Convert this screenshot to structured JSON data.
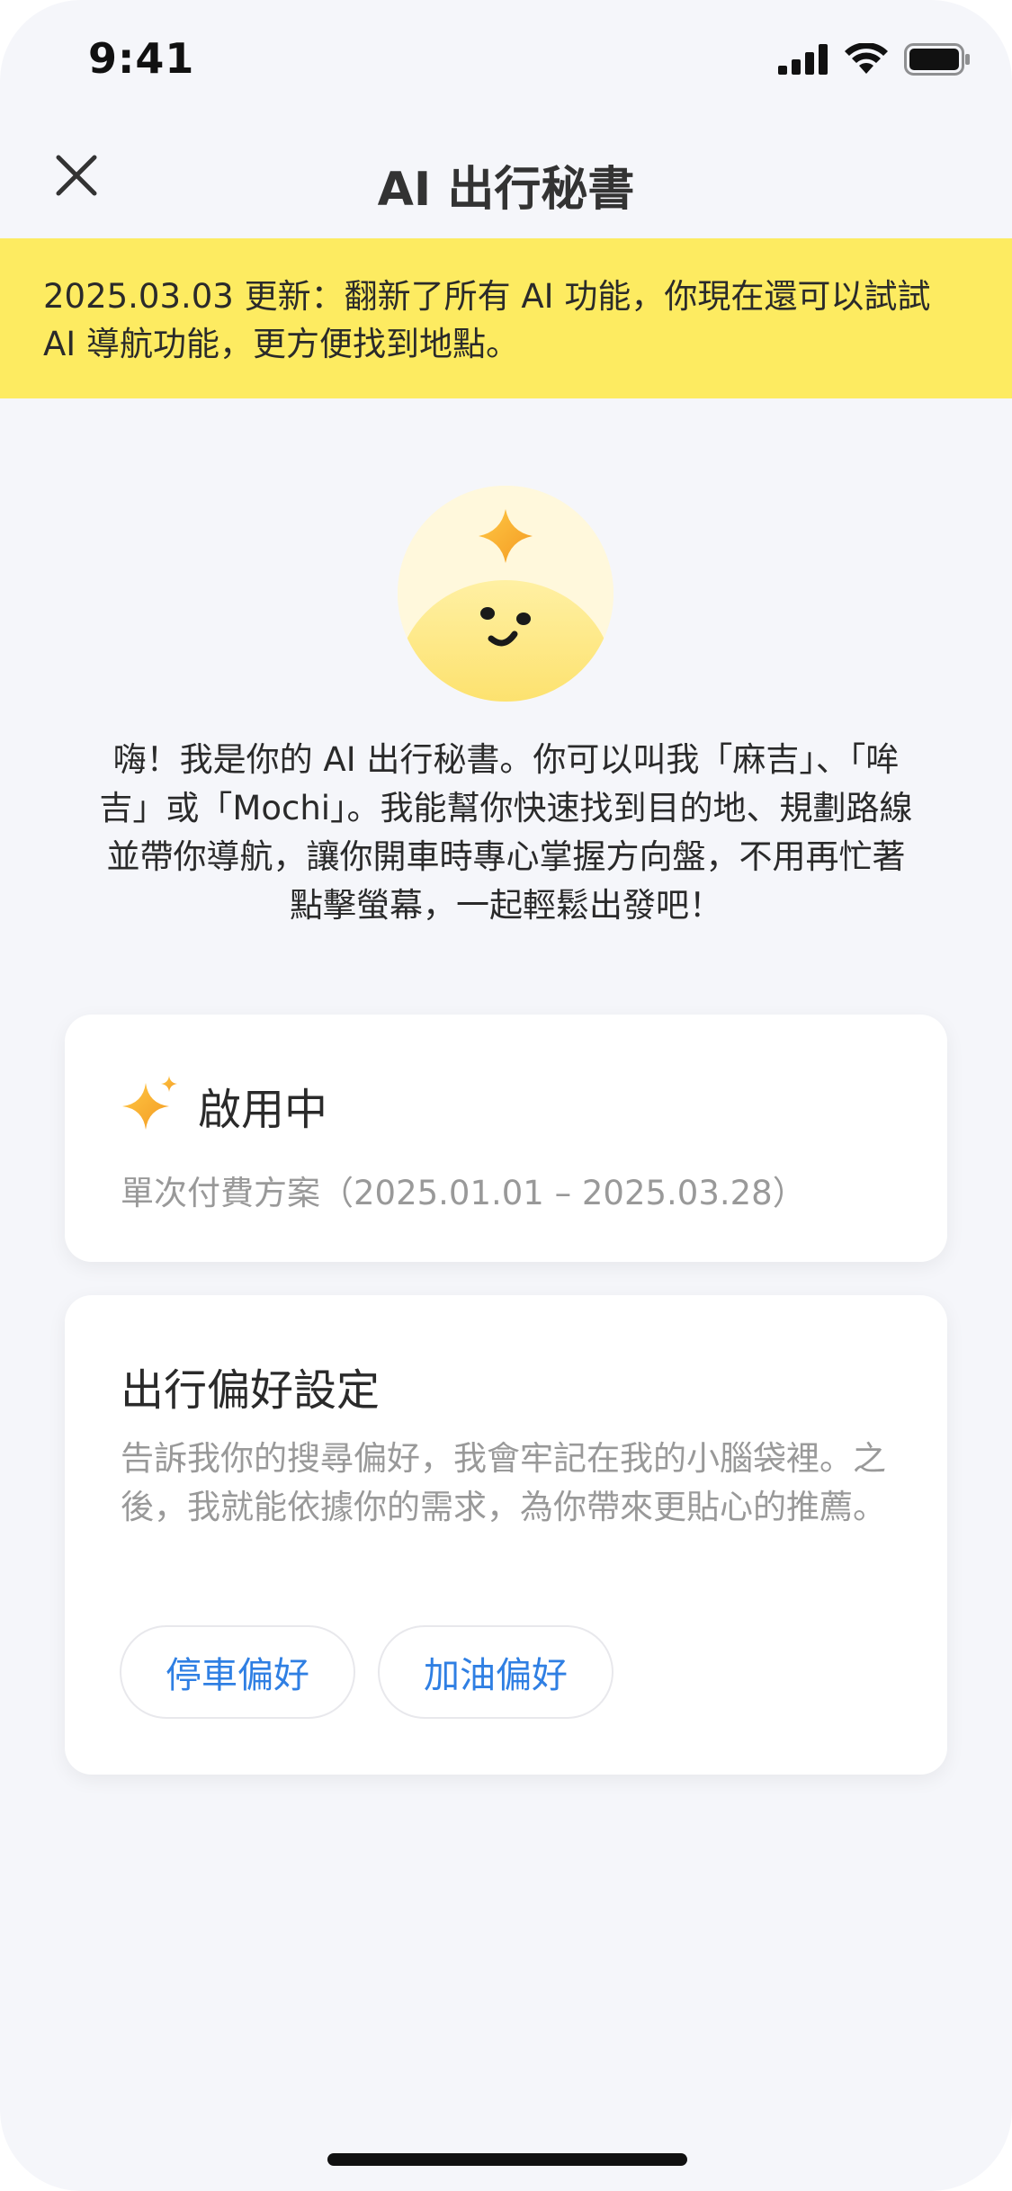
{
  "status_bar": {
    "time": "9:41",
    "signal_icon": "cellular-signal-icon",
    "wifi_icon": "wifi-icon",
    "battery_icon": "battery-icon"
  },
  "nav": {
    "title": "AI 出行秘書",
    "close_icon": "close-icon"
  },
  "banner": {
    "text": "2025.03.03 更新：翻新了所有 AI 功能，你現在還可以試試 AI 導航功能，更方便找到地點。",
    "background": "#fdeb61"
  },
  "intro": {
    "text": "嗨！我是你的 AI 出行秘書。你可以叫我「麻吉」、「哞吉」或「Mochi」。我能幫你快速找到目的地、規劃路線並帶你導航，讓你開車時專心掌握方向盤，不用再忙著點擊螢幕，一起輕鬆出發吧！"
  },
  "status_card": {
    "label": "啟用中",
    "plan": "單次付費方案（2025.01.01 – 2025.03.28）",
    "icon": "sparkle-icon"
  },
  "preferences": {
    "title": "出行偏好設定",
    "description": "告訴我你的搜尋偏好，我會牢記在我的小腦袋裡。之後，我就能依據你的需求，為你帶來更貼心的推薦。",
    "buttons": [
      {
        "label": "停車偏好"
      },
      {
        "label": "加油偏好"
      }
    ],
    "button_color": "#2f7fe3"
  },
  "colors": {
    "accent_yellow": "#fdeb61",
    "sparkle_orange": "#f7a531",
    "link_blue": "#2f7fe3",
    "background": "#f5f6fa"
  }
}
